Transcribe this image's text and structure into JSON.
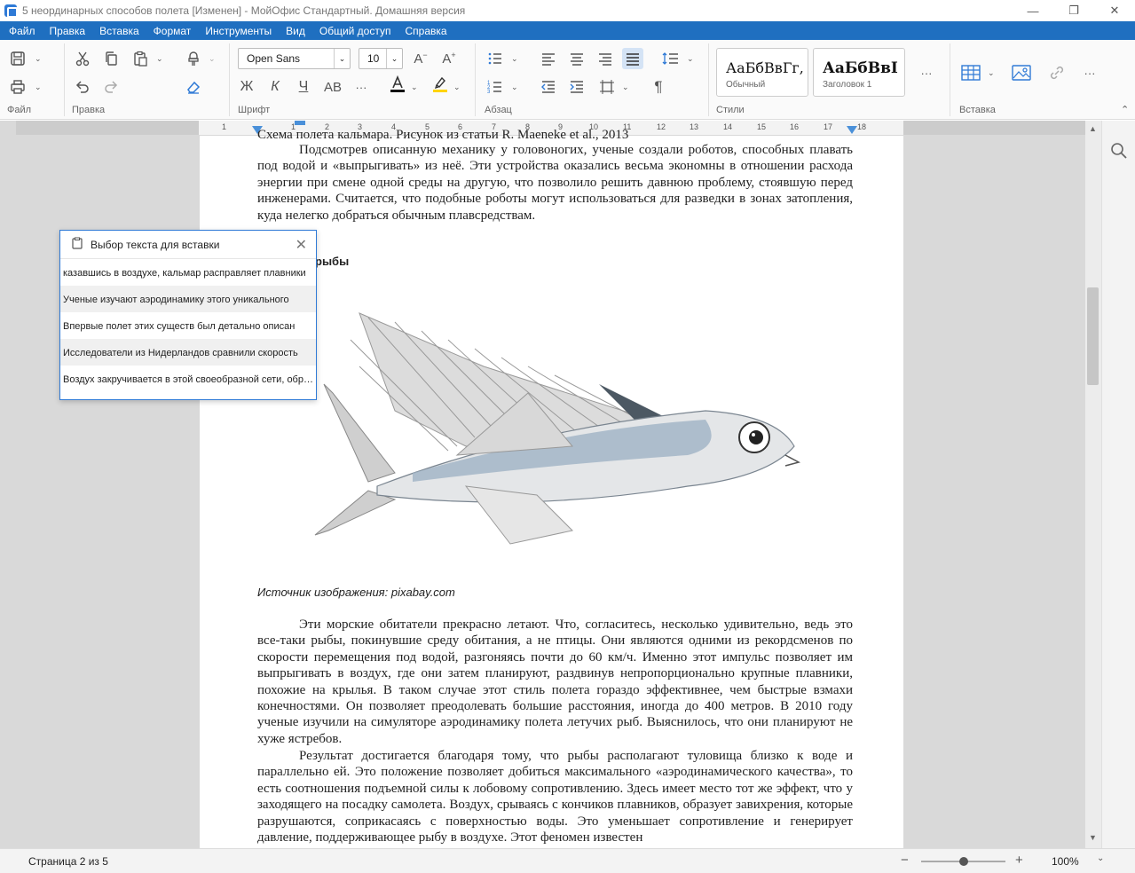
{
  "window": {
    "title": "5 неординарных способов полета [Изменен] - МойОфис Стандартный. Домашняя версия",
    "minimize": "—",
    "restore": "❐",
    "close": "✕"
  },
  "menu": [
    "Файл",
    "Правка",
    "Вставка",
    "Формат",
    "Инструменты",
    "Вид",
    "Общий доступ",
    "Справка"
  ],
  "ribbon": {
    "groups": {
      "file": "Файл",
      "edit": "Правка",
      "font": "Шрифт",
      "paragraph": "Абзац",
      "styles": "Стили",
      "insert": "Вставка"
    },
    "font_family": "Open Sans",
    "font_size": "10",
    "bold": "Ж",
    "italic": "К",
    "underline": "Ч",
    "caps": "АВ",
    "more": "···",
    "pilcrow": "¶",
    "font_color": "#111111",
    "highlight_color": "#ffd400",
    "styles": [
      {
        "sample": "АаБбВвГг,",
        "name": "Обычный"
      },
      {
        "sample": "АаБбВвI",
        "name": "Заголовок 1"
      }
    ]
  },
  "ruler": {
    "ticks": [
      "1",
      "1",
      "2",
      "3",
      "4",
      "5",
      "6",
      "7",
      "8",
      "9",
      "10",
      "11",
      "12",
      "13",
      "14",
      "15",
      "16",
      "17",
      "18"
    ]
  },
  "document": {
    "top_fragment": "Схема полета кальмара. Рисунок из статьи R. Maeneke et al., 2013",
    "para1": "Подсмотрев описанную механику у головоногих, ученые создали роботов, способных плавать под водой и «выпрыгивать» из неё. Эти устройства оказались весьма экономны в отношении расхода энергии при смене одной среды на другую, что позволило решить давнюю проблему, стоявшую перед инженерами. Считается, что подобные роботы могут использоваться для разведки в зонах затопления, куда нелегко добраться обычным плавсредствам.",
    "heading": "рыбы",
    "caption": "Источник изображения: pixabay.com",
    "para2": "Эти морские обитатели прекрасно летают. Что, согласитесь, несколько удивительно, ведь это все-таки рыбы, покинувшие среду обитания, а не птицы. Они являются одними из рекордсменов по скорости перемещения под водой, разгоняясь почти до 60 км/ч. Именно этот импульс позволяет им выпрыгивать в воздух, где они затем планируют, раздвинув непропорционально крупные плавники, похожие на крылья. В таком случае этот стиль полета гораздо эффективнее, чем быстрые взмахи конечностями. Он позволяет преодолевать большие расстояния, иногда до 400 метров.  В 2010 году ученые изучили на симуляторе аэродинамику полета летучих рыб. Выяснилось, что они планируют не хуже ястребов.",
    "para3": "Результат достигается благодаря тому, что рыбы располагают туловища близко к воде и параллельно ей. Это положение позволяет добиться максимального «аэродинамического качества», то есть соотношения подъемной силы к лобовому сопротивлению. Здесь имеет место тот же эффект, что у заходящего на посадку самолета. Воздух, срываясь с кончиков плавников, образует завихрения, которые разрушаются, соприкасаясь с поверхностью воды. Это уменьшает сопротивление и генерирует давление, поддерживающее рыбу в воздухе. Этот феномен известен"
  },
  "paste_popup": {
    "title": "Выбор текста для вставки",
    "items": [
      "казавшись в воздухе, кальмар расправляет плавники",
      "Ученые изучают аэродинамику этого уникального",
      "Впервые полет этих существ был детально описан",
      " Исследователи из Нидерландов сравнили скорость",
      "Воздух закручивается в этой своеобразной сети, образуя"
    ]
  },
  "status": {
    "page": "Страница 2 из 5",
    "zoom": "100%",
    "zoom_fraction": 0.5,
    "minus": "−",
    "plus": "+"
  }
}
